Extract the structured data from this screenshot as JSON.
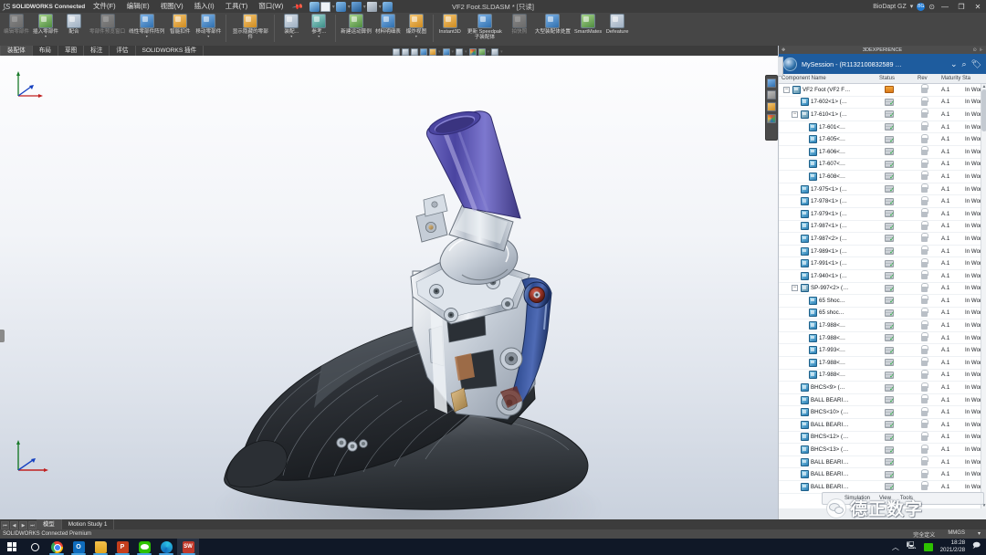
{
  "titlebar": {
    "app_name": "SOLIDWORKS Connected",
    "menus": [
      "文件(F)",
      "编辑(E)",
      "视图(V)",
      "插入(I)",
      "工具(T)",
      "窗口(W)"
    ],
    "pin_icon": "pushpin-icon",
    "quick_access": [
      "home-icon",
      "new-doc-icon",
      "open-icon",
      "save-icon",
      "print-icon",
      "undo-icon"
    ],
    "document_title": "VF2 Foot.SLDASM * [只读]",
    "account": "BioDapt GZ",
    "avatar_initials": "BG",
    "help_icon": "help-icon",
    "minimize": "—",
    "maximize": "❐",
    "close": "✕"
  },
  "ribbon": {
    "groups": [
      {
        "buttons": [
          {
            "label": "编辑零部件",
            "icon": "edit-component-icon",
            "style": "grey",
            "caret": false
          },
          {
            "label": "插入零部件",
            "icon": "insert-component-icon",
            "style": "green",
            "caret": true
          },
          {
            "label": "配合",
            "icon": "mate-icon",
            "style": "default",
            "caret": false
          },
          {
            "label": "零部件预览窗口",
            "icon": "preview-window-icon",
            "style": "grey",
            "caret": false
          },
          {
            "label": "线性零部件阵列",
            "icon": "linear-pattern-icon",
            "style": "blue",
            "caret": true
          },
          {
            "label": "智能扣件",
            "icon": "smart-fastener-icon",
            "style": "orange",
            "caret": false
          },
          {
            "label": "移动零部件",
            "icon": "move-component-icon",
            "style": "blue",
            "caret": true
          }
        ]
      },
      {
        "buttons": [
          {
            "label": "显示隐藏的零部件",
            "icon": "show-hidden-icon",
            "style": "orange",
            "caret": false
          }
        ]
      },
      {
        "buttons": [
          {
            "label": "装配...",
            "icon": "assembly-feature-icon",
            "style": "default",
            "caret": true
          },
          {
            "label": "参考...",
            "icon": "reference-geometry-icon",
            "style": "teal",
            "caret": true
          }
        ]
      },
      {
        "buttons": [
          {
            "label": "新建运动算例",
            "icon": "new-motion-study-icon",
            "style": "green",
            "caret": false
          },
          {
            "label": "材料明细表",
            "icon": "bom-icon",
            "style": "blue",
            "caret": false
          },
          {
            "label": "爆炸视图",
            "icon": "exploded-view-icon",
            "style": "orange",
            "caret": true
          }
        ]
      },
      {
        "buttons": [
          {
            "label": "Instant3D",
            "icon": "instant3d-icon",
            "style": "orange",
            "caret": false
          },
          {
            "label": "更新 Speedpak 子装配体",
            "icon": "update-speedpak-icon",
            "style": "blue",
            "caret": false
          },
          {
            "label": "拍快照",
            "icon": "snapshot-icon",
            "style": "grey",
            "caret": false
          },
          {
            "label": "大型装配体处置",
            "icon": "large-assembly-icon",
            "style": "blue",
            "caret": false
          },
          {
            "label": "SmartMates",
            "icon": "smartmates-icon",
            "style": "green",
            "caret": false
          },
          {
            "label": "Defeature",
            "icon": "defeature-icon",
            "style": "default",
            "caret": false
          }
        ]
      }
    ]
  },
  "tabs": {
    "items": [
      "装配体",
      "布局",
      "草图",
      "标注",
      "评估",
      "SOLIDWORKS 插件"
    ],
    "active_index": 0
  },
  "view_toolbar": {
    "icons": [
      "zoom-to-fit-icon",
      "zoom-to-area-icon",
      "zoom-in-out-icon",
      "previous-view-icon",
      "section-view-icon",
      "view-orientation-icon",
      "display-style-icon",
      "hide-show-icon",
      "appearance-icon",
      "scene-icon",
      "view-settings-icon"
    ]
  },
  "right_panel": {
    "window_title": "3DEXPERIENCE",
    "session_name": "MySession - (R1132100832589 …",
    "dropdown_icon": "chevron-down-icon",
    "search_icon": "search-icon",
    "tag_icon": "tag-icon",
    "columns": [
      "Component Name",
      "Status",
      "Rev",
      "Maturity Sta"
    ],
    "rows": [
      {
        "name": "VF2 Foot (VF2 F…",
        "indent": 0,
        "expander": "−",
        "icon": "assembly-icon",
        "status": "modified",
        "rev": "A.1",
        "maturity": "In Work"
      },
      {
        "name": "17-602<1> (…",
        "indent": 1,
        "expander": "",
        "icon": "part-icon",
        "status": "ok",
        "rev": "A.1",
        "maturity": "In Work"
      },
      {
        "name": "17-610<1> (…",
        "indent": 1,
        "expander": "−",
        "icon": "assembly-icon",
        "status": "ok",
        "rev": "A.1",
        "maturity": "In Work"
      },
      {
        "name": "17-601<…",
        "indent": 2,
        "expander": "",
        "icon": "part-icon",
        "status": "ok",
        "rev": "A.1",
        "maturity": "In Work"
      },
      {
        "name": "17-605<…",
        "indent": 2,
        "expander": "",
        "icon": "part-icon",
        "status": "ok",
        "rev": "A.1",
        "maturity": "In Work"
      },
      {
        "name": "17-606<…",
        "indent": 2,
        "expander": "",
        "icon": "part-icon",
        "status": "ok",
        "rev": "A.1",
        "maturity": "In Work"
      },
      {
        "name": "17-607<…",
        "indent": 2,
        "expander": "",
        "icon": "part-icon",
        "status": "ok",
        "rev": "A.1",
        "maturity": "In Work"
      },
      {
        "name": "17-608<…",
        "indent": 2,
        "expander": "",
        "icon": "part-icon",
        "status": "ok",
        "rev": "A.1",
        "maturity": "In Work"
      },
      {
        "name": "17-975<1> (…",
        "indent": 1,
        "expander": "",
        "icon": "part-icon",
        "status": "ok",
        "rev": "A.1",
        "maturity": "In Work"
      },
      {
        "name": "17-978<1> (…",
        "indent": 1,
        "expander": "",
        "icon": "part-icon",
        "status": "ok",
        "rev": "A.1",
        "maturity": "In Work"
      },
      {
        "name": "17-979<1> (…",
        "indent": 1,
        "expander": "",
        "icon": "part-icon",
        "status": "ok",
        "rev": "A.1",
        "maturity": "In Work"
      },
      {
        "name": "17-987<1> (…",
        "indent": 1,
        "expander": "",
        "icon": "part-icon",
        "status": "ok",
        "rev": "A.1",
        "maturity": "In Work"
      },
      {
        "name": "17-987<2> (…",
        "indent": 1,
        "expander": "",
        "icon": "part-icon",
        "status": "ok",
        "rev": "A.1",
        "maturity": "In Work"
      },
      {
        "name": "17-989<1> (…",
        "indent": 1,
        "expander": "",
        "icon": "part-icon",
        "status": "ok",
        "rev": "A.1",
        "maturity": "In Work"
      },
      {
        "name": "17-991<1> (…",
        "indent": 1,
        "expander": "",
        "icon": "part-icon",
        "status": "ok",
        "rev": "A.1",
        "maturity": "In Work"
      },
      {
        "name": "17-940<1> (…",
        "indent": 1,
        "expander": "",
        "icon": "part-icon",
        "status": "ok",
        "rev": "A.1",
        "maturity": "In Work"
      },
      {
        "name": "SP-997<2> (…",
        "indent": 1,
        "expander": "−",
        "icon": "assembly-icon",
        "status": "ok",
        "rev": "A.1",
        "maturity": "In Work"
      },
      {
        "name": "65 Shoc…",
        "indent": 2,
        "expander": "",
        "icon": "part-icon",
        "status": "ok",
        "rev": "A.1",
        "maturity": "In Work"
      },
      {
        "name": "65 shoc…",
        "indent": 2,
        "expander": "",
        "icon": "part-icon",
        "status": "ok",
        "rev": "A.1",
        "maturity": "In Work"
      },
      {
        "name": "17-988<…",
        "indent": 2,
        "expander": "",
        "icon": "part-icon",
        "status": "ok",
        "rev": "A.1",
        "maturity": "In Work"
      },
      {
        "name": "17-988<…",
        "indent": 2,
        "expander": "",
        "icon": "part-icon",
        "status": "ok",
        "rev": "A.1",
        "maturity": "In Work"
      },
      {
        "name": "17-993<…",
        "indent": 2,
        "expander": "",
        "icon": "part-icon",
        "status": "ok",
        "rev": "A.1",
        "maturity": "In Work"
      },
      {
        "name": "17-988<…",
        "indent": 2,
        "expander": "",
        "icon": "part-icon",
        "status": "ok",
        "rev": "A.1",
        "maturity": "In Work"
      },
      {
        "name": "17-988<…",
        "indent": 2,
        "expander": "",
        "icon": "part-icon",
        "status": "ok",
        "rev": "A.1",
        "maturity": "In Work"
      },
      {
        "name": "BHCS<9> (…",
        "indent": 1,
        "expander": "",
        "icon": "part-icon",
        "status": "ok",
        "rev": "A.1",
        "maturity": "In Work"
      },
      {
        "name": "BALL BEARI…",
        "indent": 1,
        "expander": "",
        "icon": "part-icon",
        "status": "ok",
        "rev": "A.1",
        "maturity": "In Work"
      },
      {
        "name": "BHCS<10> (…",
        "indent": 1,
        "expander": "",
        "icon": "part-icon",
        "status": "ok",
        "rev": "A.1",
        "maturity": "In Work"
      },
      {
        "name": "BALL BEARI…",
        "indent": 1,
        "expander": "",
        "icon": "part-icon",
        "status": "ok",
        "rev": "A.1",
        "maturity": "In Work"
      },
      {
        "name": "BHCS<12> (…",
        "indent": 1,
        "expander": "",
        "icon": "part-icon",
        "status": "ok",
        "rev": "A.1",
        "maturity": "In Work"
      },
      {
        "name": "BHCS<13> (…",
        "indent": 1,
        "expander": "",
        "icon": "part-icon",
        "status": "ok",
        "rev": "A.1",
        "maturity": "In Work"
      },
      {
        "name": "BALL BEARI…",
        "indent": 1,
        "expander": "",
        "icon": "part-icon",
        "status": "ok",
        "rev": "A.1",
        "maturity": "In Work"
      },
      {
        "name": "BALL BEARI…",
        "indent": 1,
        "expander": "",
        "icon": "part-icon",
        "status": "ok",
        "rev": "A.1",
        "maturity": "In Work"
      },
      {
        "name": "BALL BEARI…",
        "indent": 1,
        "expander": "",
        "icon": "part-icon",
        "status": "ok",
        "rev": "A.1",
        "maturity": "In Work"
      }
    ]
  },
  "floating_bar": {
    "items": [
      "Simulation",
      "View",
      "Tools"
    ]
  },
  "watermark": {
    "text": "德正数字",
    "icon": "wechat-icon"
  },
  "bottom_tabs": {
    "nav_icons": [
      "⏮",
      "◀",
      "▶",
      "⏭"
    ],
    "items": [
      "模型",
      "Motion Study 1"
    ],
    "active_index": 0
  },
  "statusbar": {
    "left": "SOLIDWORKS Connected Premium",
    "state": "完全定义",
    "units": "MMGS",
    "units_caret": "▾"
  },
  "taskbar": {
    "start_icon": "windows-start-icon",
    "search_icon": "cortana-circle-icon",
    "apps": [
      {
        "name": "chrome-icon",
        "style": "chrome",
        "glyph": "",
        "running": true
      },
      {
        "name": "outlook-icon",
        "style": "outlook",
        "glyph": "O",
        "running": true
      },
      {
        "name": "file-explorer-icon",
        "style": "folder",
        "glyph": "",
        "running": true
      },
      {
        "name": "powerpoint-icon",
        "style": "ppt",
        "glyph": "P",
        "running": true
      },
      {
        "name": "wechat-icon",
        "style": "wechat",
        "glyph": "",
        "running": true
      },
      {
        "name": "edge-icon",
        "style": "edge",
        "glyph": "",
        "running": true
      },
      {
        "name": "solidworks-icon",
        "style": "sw",
        "glyph": "SW",
        "running": true
      }
    ],
    "tray": {
      "chevron": "︿",
      "network_icon": "network-icon",
      "sync_icon": "sync-icon",
      "time": "18:28",
      "date": "2021/2/28",
      "notification_icon": "notification-icon"
    }
  },
  "colors": {
    "accent_blue": "#1e5c9e",
    "ribbon_bg": "#464646",
    "panel_bg": "#eceff2",
    "status_green": "#1aa832",
    "model_purple": "#5b56ad",
    "model_dark": "#3a3f45"
  }
}
